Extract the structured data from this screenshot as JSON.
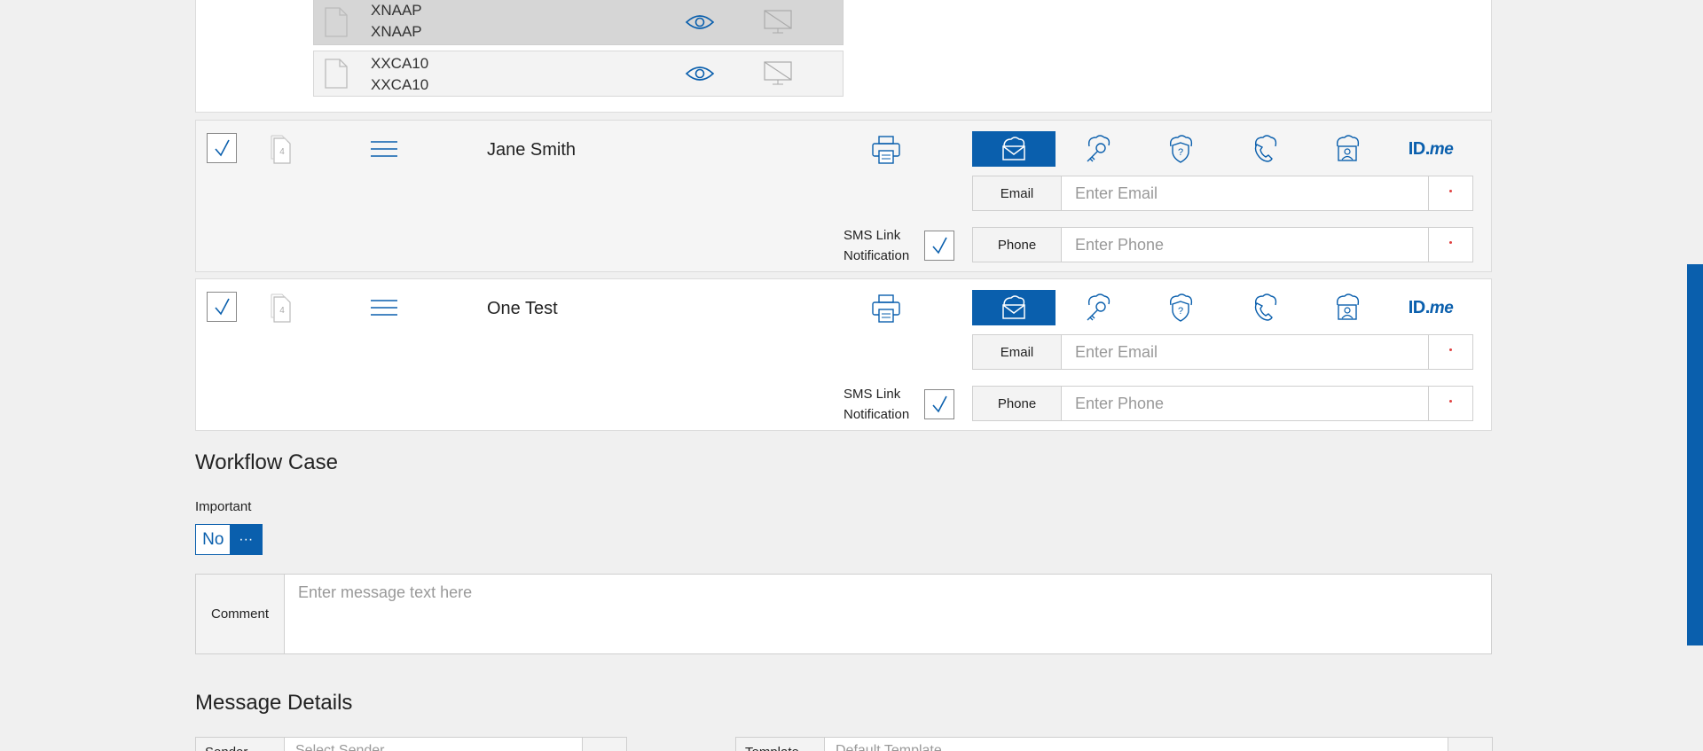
{
  "documents": [
    {
      "name_line1": "XNAAP",
      "name_line2": "XNAAP",
      "icon": "file-icon",
      "view_icon": "eye-icon",
      "disabled_icon": "screen-off-icon"
    },
    {
      "name_line1": "XXCA10",
      "name_line2": "XXCA10",
      "icon": "file-icon",
      "view_icon": "eye-icon",
      "disabled_icon": "screen-off-icon"
    }
  ],
  "signers": [
    {
      "name": "Jane Smith",
      "page_count": "4",
      "email_label": "Email",
      "email_placeholder": "Enter Email",
      "phone_label": "Phone",
      "phone_placeholder": "Enter Phone",
      "sms_line1": "SMS Link",
      "sms_line2": "Notification"
    },
    {
      "name": "One Test",
      "page_count": "4",
      "email_label": "Email",
      "email_placeholder": "Enter Email",
      "phone_label": "Phone",
      "phone_placeholder": "Enter Phone",
      "sms_line1": "SMS Link",
      "sms_line2": "Notification"
    }
  ],
  "auth_methods": [
    "email-auth-icon",
    "key-auth-icon",
    "question-auth-icon",
    "phone-auth-icon",
    "id-auth-icon",
    "idme-logo"
  ],
  "idme": {
    "id": "ID.",
    "me": "me"
  },
  "workflow": {
    "title": "Workflow Case",
    "important_label": "Important",
    "important_value": "No",
    "important_more": "···",
    "comment_label": "Comment",
    "comment_placeholder": "Enter message text here"
  },
  "message_details": {
    "title": "Message Details",
    "field1_label": "Sender",
    "field1_value": "Select Sender",
    "field2_label": "Template",
    "field2_value": "Default Template"
  },
  "colors": {
    "accent": "#0a5fad",
    "required": "#e04040"
  }
}
